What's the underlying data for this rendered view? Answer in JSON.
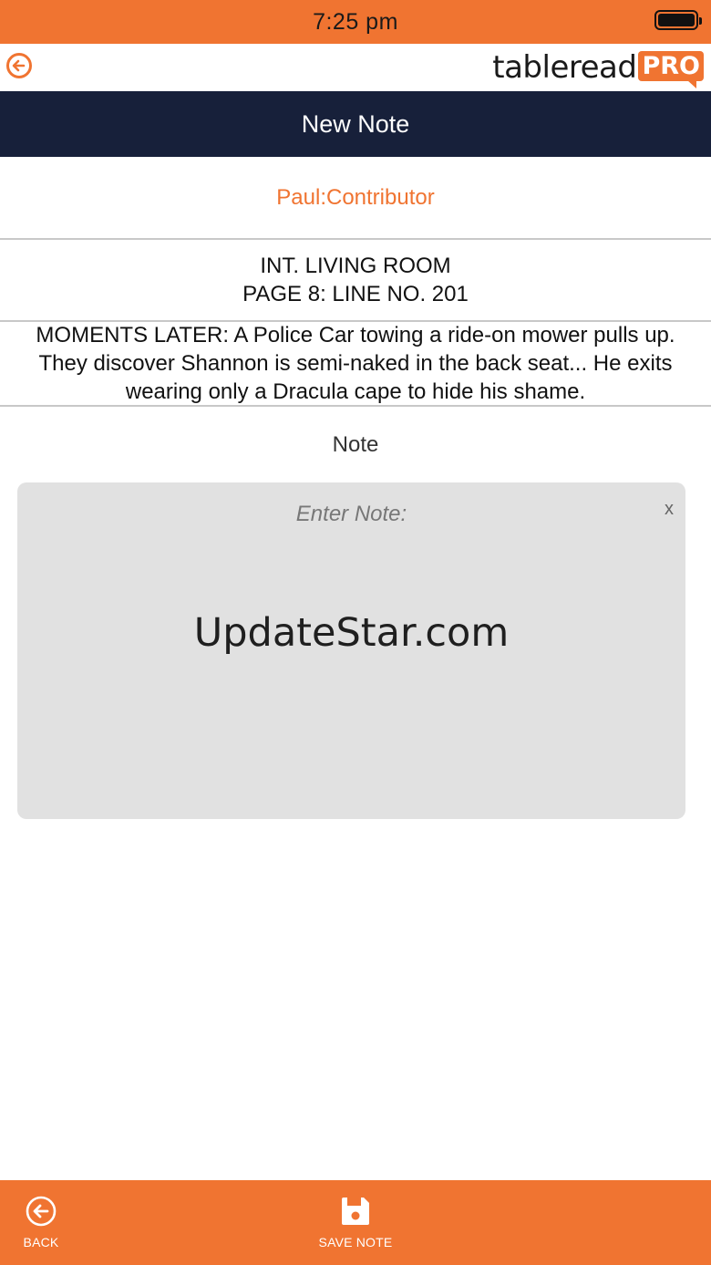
{
  "status_bar": {
    "time": "7:25 pm"
  },
  "header": {
    "logo_text": "tableread",
    "logo_badge": "PRO"
  },
  "title": "New Note",
  "contributor": "Paul:Contributor",
  "scene": {
    "heading": "INT. LIVING ROOM",
    "location": "PAGE 8: LINE NO. 201",
    "description": "MOMENTS LATER: A Police Car towing a ride-on mower pulls up.  They discover Shannon is semi-naked in the back seat... He exits wearing only a Dracula cape to hide his shame."
  },
  "note": {
    "label": "Note",
    "placeholder": "Enter Note:",
    "clear_label": "x",
    "watermark": "UpdateStar.com"
  },
  "bottom_bar": {
    "back_label": "BACK",
    "save_label": "SAVE NOTE"
  },
  "colors": {
    "accent": "#f07431",
    "title_bar": "#17203a",
    "note_bg": "#e1e1e1"
  }
}
